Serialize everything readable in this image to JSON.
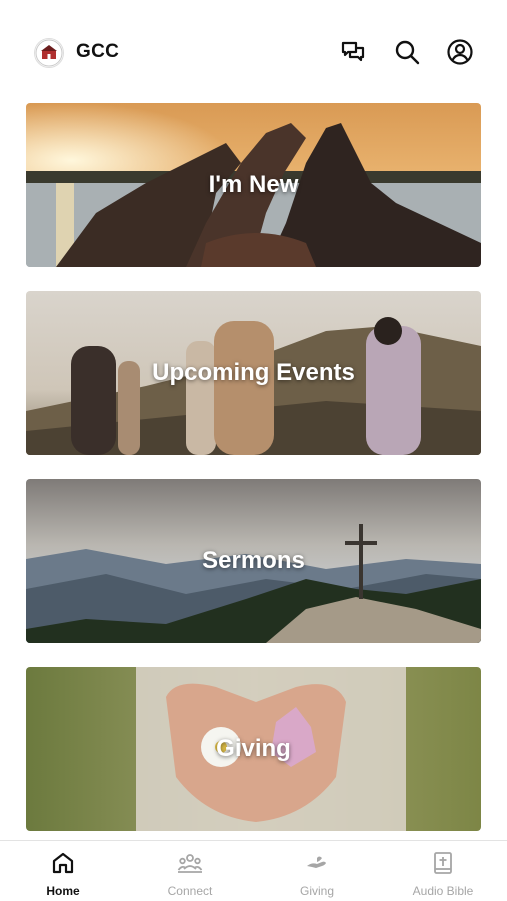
{
  "header": {
    "title": "GCC",
    "logo_icon": "church-logo",
    "icons": [
      "chat-icon",
      "search-icon",
      "account-icon"
    ]
  },
  "cards": [
    {
      "label": "I'm New"
    },
    {
      "label": "Upcoming Events"
    },
    {
      "label": "Sermons"
    },
    {
      "label": "Giving"
    }
  ],
  "tabs": [
    {
      "label": "Home",
      "icon": "home-icon",
      "active": true
    },
    {
      "label": "Connect",
      "icon": "group-icon",
      "active": false
    },
    {
      "label": "Giving",
      "icon": "giving-hand-icon",
      "active": false
    },
    {
      "label": "Audio Bible",
      "icon": "bible-icon",
      "active": false
    }
  ],
  "colors": {
    "active_tab": "#111111",
    "inactive_tab": "#a6a6a6",
    "divider": "#e3e3e3"
  }
}
